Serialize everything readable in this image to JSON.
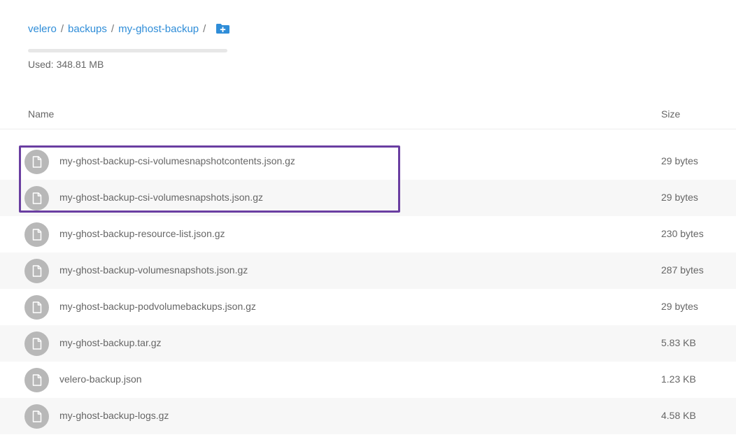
{
  "breadcrumb": {
    "items": [
      "velero",
      "backups",
      "my-ghost-backup"
    ],
    "separator": "/",
    "new_folder_icon": "folder-plus-icon"
  },
  "usage": {
    "label": "Used:",
    "value": "348.81 MB",
    "fill_fraction": 0.0
  },
  "table": {
    "headers": {
      "name": "Name",
      "size": "Size"
    },
    "rows": [
      {
        "name": "my-ghost-backup-csi-volumesnapshotcontents.json.gz",
        "size": "29 bytes",
        "icon": "file-icon"
      },
      {
        "name": "my-ghost-backup-csi-volumesnapshots.json.gz",
        "size": "29 bytes",
        "icon": "file-icon"
      },
      {
        "name": "my-ghost-backup-resource-list.json.gz",
        "size": "230 bytes",
        "icon": "file-icon"
      },
      {
        "name": "my-ghost-backup-volumesnapshots.json.gz",
        "size": "287 bytes",
        "icon": "file-icon"
      },
      {
        "name": "my-ghost-backup-podvolumebackups.json.gz",
        "size": "29 bytes",
        "icon": "file-icon"
      },
      {
        "name": "my-ghost-backup.tar.gz",
        "size": "5.83 KB",
        "icon": "file-icon"
      },
      {
        "name": "velero-backup.json",
        "size": "1.23 KB",
        "icon": "file-icon"
      },
      {
        "name": "my-ghost-backup-logs.gz",
        "size": "4.58 KB",
        "icon": "file-icon"
      }
    ]
  },
  "colors": {
    "link": "#2f8dd8",
    "highlight": "#6a3ea1",
    "row_alt": "#f7f7f7",
    "file_icon_bg": "#b8b8b8"
  }
}
